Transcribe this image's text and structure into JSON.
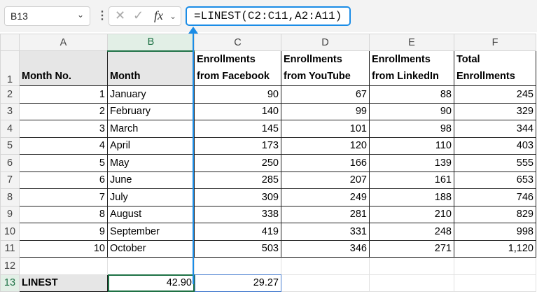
{
  "name_box": "B13",
  "formula": "=LINEST(C2:C11,A2:A11)",
  "columns": [
    "A",
    "B",
    "C",
    "D",
    "E",
    "F"
  ],
  "headers": [
    "Month No.",
    "Month",
    "Enrollments from Facebook",
    "Enrollments from YouTube",
    "Enrollments from LinkedIn",
    "Total Enrollments"
  ],
  "rows": [
    [
      "1",
      "January",
      "90",
      "67",
      "88",
      "245"
    ],
    [
      "2",
      "February",
      "140",
      "99",
      "90",
      "329"
    ],
    [
      "3",
      "March",
      "145",
      "101",
      "98",
      "344"
    ],
    [
      "4",
      "April",
      "173",
      "120",
      "110",
      "403"
    ],
    [
      "5",
      "May",
      "250",
      "166",
      "139",
      "555"
    ],
    [
      "6",
      "June",
      "285",
      "207",
      "161",
      "653"
    ],
    [
      "7",
      "July",
      "309",
      "249",
      "188",
      "746"
    ],
    [
      "8",
      "August",
      "338",
      "281",
      "210",
      "829"
    ],
    [
      "9",
      "September",
      "419",
      "331",
      "248",
      "998"
    ],
    [
      "10",
      "October",
      "503",
      "346",
      "271",
      "1,120"
    ]
  ],
  "row_numbers": [
    "1",
    "2",
    "3",
    "4",
    "5",
    "6",
    "7",
    "8",
    "9",
    "10",
    "11",
    "12",
    "13"
  ],
  "linest": {
    "label": "LINEST",
    "slope": "42.90",
    "intercept": "29.27"
  }
}
